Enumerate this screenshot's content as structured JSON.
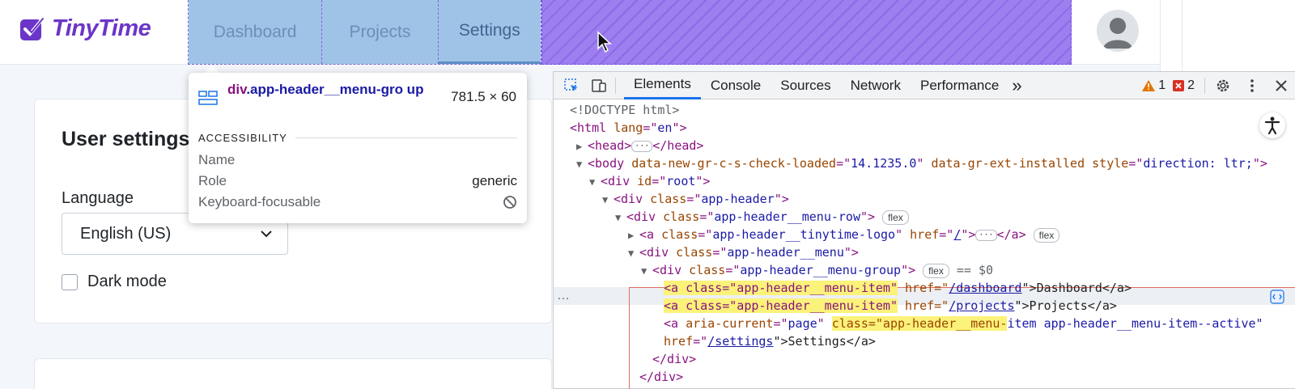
{
  "app": {
    "logo_text": "TinyTime",
    "menu": [
      {
        "label": "Dashboard"
      },
      {
        "label": "Projects"
      },
      {
        "label": "Settings"
      }
    ]
  },
  "settings": {
    "title": "User settings",
    "language_label": "Language",
    "language_value": "English (US)",
    "dark_mode_label": "Dark mode"
  },
  "tooltip": {
    "tag": "div",
    "class": ".app-header__menu-gro up",
    "size": "781.5 × 60",
    "section": "ACCESSIBILITY",
    "rows": [
      {
        "key": "Name",
        "value": ""
      },
      {
        "key": "Role",
        "value": "generic"
      },
      {
        "key": "Keyboard-focusable",
        "value": ""
      }
    ]
  },
  "devtools": {
    "tabs": [
      "Elements",
      "Console",
      "Sources",
      "Network",
      "Performance"
    ],
    "more": "»",
    "warnings": "1",
    "errors": "2",
    "lines": {
      "doctype": "<!DOCTYPE html>",
      "l1": [
        "<html ",
        "lang",
        "=\"",
        "en",
        "\">"
      ],
      "l2": [
        "<head>",
        "</head>"
      ],
      "l3": [
        "<body ",
        "data-new-gr-c-s-check-loaded",
        "=\"",
        "14.1235.0",
        "\" ",
        "data-gr-ext-installed",
        " ",
        "style",
        "=\"",
        "direction: ltr;",
        "\">"
      ],
      "l4": [
        "<div ",
        "id",
        "=\"",
        "root",
        "\">"
      ],
      "l5": [
        "<div ",
        "class",
        "=\"",
        "app-header",
        "\">"
      ],
      "l6": [
        "<div ",
        "class",
        "=\"",
        "app-header__menu-row",
        "\">"
      ],
      "l7": [
        "<a ",
        "class",
        "=\"",
        "app-header__tinytime-logo",
        "\" ",
        "href",
        "=\"",
        "/",
        "\">",
        "</a>"
      ],
      "l8": [
        "<div ",
        "class",
        "=\"",
        "app-header__menu",
        "\">"
      ],
      "l9": [
        "<div ",
        "class",
        "=\"",
        "app-header__menu-group",
        "\">",
        "== $0"
      ],
      "l10": [
        "<a class=\"app-header__menu-item\"",
        " href=\"",
        "/dashboard",
        "\">Dashboard</a>"
      ],
      "l11": [
        "<a class=\"app-header__menu-item\"",
        " href=\"",
        "/projects",
        "\">Projects</a>"
      ],
      "l12": [
        "<a ",
        "aria-current",
        "=\"",
        "page",
        "\" ",
        "class=\"app-header__menu-",
        "item app-header__menu-item--active\""
      ],
      "l13": [
        "href",
        "=\"",
        "/settings",
        "\">Settings</a>"
      ],
      "l14": "</div>",
      "l15": "</div>",
      "flex": "flex"
    }
  },
  "colors": {
    "brand": "#6b35c9",
    "menu_overlay": "#9fc3e6",
    "padding_overlay": "#9d7ff0",
    "highlight": "#fbf27a",
    "selection_border": "#e06c60"
  }
}
